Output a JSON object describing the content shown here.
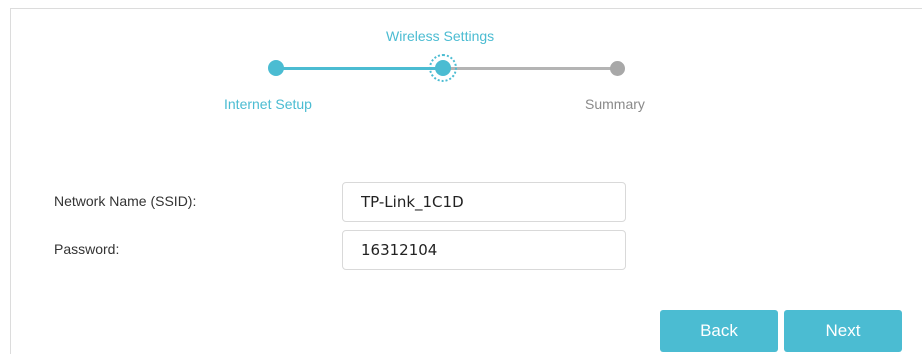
{
  "stepper": {
    "steps": [
      {
        "label": "Internet Setup",
        "state": "done"
      },
      {
        "label": "Wireless Settings",
        "state": "current"
      },
      {
        "label": "Summary",
        "state": "pending"
      }
    ],
    "colors": {
      "active": "#4bbcd2",
      "inactive": "#a8a8a8"
    }
  },
  "form": {
    "ssid_label": "Network Name (SSID):",
    "ssid_value": "TP-Link_1C1D",
    "password_label": "Password:",
    "password_value": "16312104"
  },
  "buttons": {
    "back_label": "Back",
    "next_label": "Next"
  }
}
